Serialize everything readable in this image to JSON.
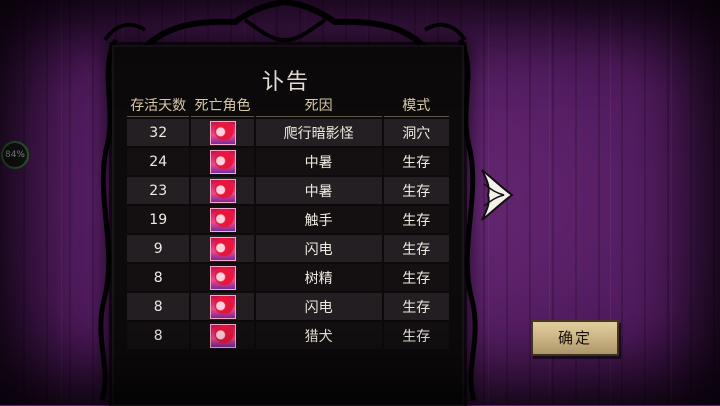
{
  "screen": {
    "title": "讣告",
    "confirm_label": "确定",
    "percent_indicator": "84%",
    "columns": {
      "days": "存活天数",
      "character": "死亡角色",
      "cause": "死因",
      "mode": "模式"
    },
    "rows": [
      {
        "days": "32",
        "cause": "爬行暗影怪",
        "mode": "洞穴"
      },
      {
        "days": "24",
        "cause": "中暑",
        "mode": "生存"
      },
      {
        "days": "23",
        "cause": "中暑",
        "mode": "生存"
      },
      {
        "days": "19",
        "cause": "触手",
        "mode": "生存"
      },
      {
        "days": "9",
        "cause": "闪电",
        "mode": "生存"
      },
      {
        "days": "8",
        "cause": "树精",
        "mode": "生存"
      },
      {
        "days": "8",
        "cause": "闪电",
        "mode": "生存"
      },
      {
        "days": "8",
        "cause": "猎犬",
        "mode": "生存"
      }
    ],
    "icons": {
      "portrait": "character-portrait-icon",
      "next": "next-arrow-icon"
    },
    "colors": {
      "background": "#5a1f66",
      "panel": "#0d0a0c",
      "button": "#d5b983",
      "text": "#f0ebe2"
    }
  }
}
